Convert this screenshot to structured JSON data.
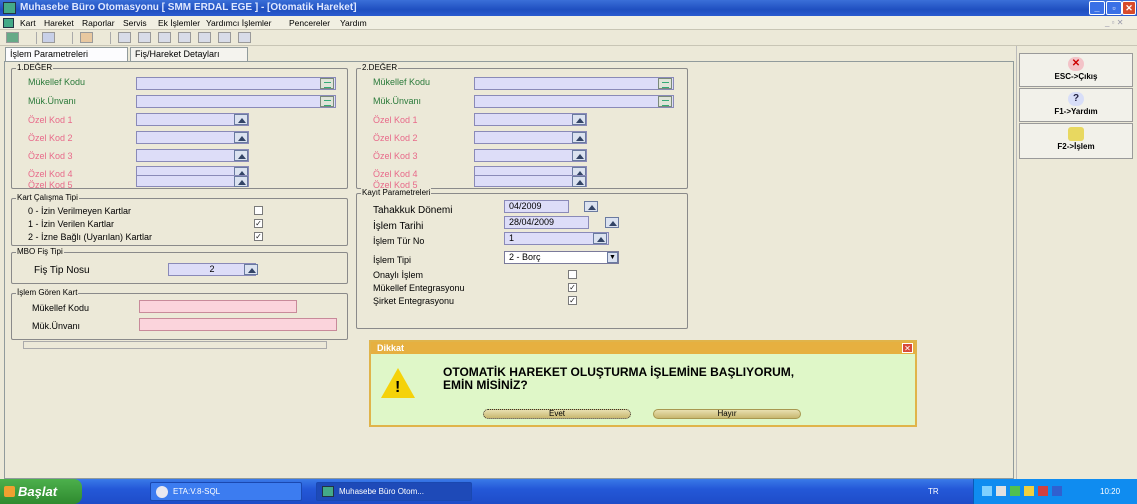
{
  "window": {
    "title": "Muhasebe Büro Otomasyonu [ SMM ERDAL EGE ] - [Otomatik Hareket]"
  },
  "menu": [
    "Kart",
    "Hareket",
    "Raporlar",
    "Servis",
    "Ek İşlemler",
    "Yardımcı İşlemler",
    "Pencereler",
    "Yardım"
  ],
  "tabs": [
    "İşlem Parametreleri",
    "Fiş/Hareket Detayları"
  ],
  "deger1": {
    "title": "1.DEĞER",
    "mukellef_kodu": "Mükellef Kodu",
    "muk_unvani": "Mük.Ünvanı",
    "ozel_kod": [
      "Özel Kod 1",
      "Özel Kod 2",
      "Özel Kod 3",
      "Özel Kod 4",
      "Özel Kod 5"
    ]
  },
  "deger2": {
    "title": "2.DEĞER",
    "mukellef_kodu": "Mükellef Kodu",
    "muk_unvani": "Mük.Ünvanı",
    "ozel_kod": [
      "Özel Kod 1",
      "Özel Kod 2",
      "Özel Kod 3",
      "Özel Kod 4",
      "Özel Kod 5"
    ]
  },
  "kart_calisma": {
    "title": "Kart Çalışma Tipi",
    "items": [
      {
        "label": "0 - İzin Verilmeyen Kartlar",
        "checked": false
      },
      {
        "label": "1 - İzin Verilen Kartlar",
        "checked": true
      },
      {
        "label": "2 - İzne Bağlı (Uyarılan) Kartlar",
        "checked": true
      }
    ]
  },
  "mbo": {
    "title": "MBO Fiş Tipi",
    "label": "Fiş Tip Nosu",
    "value": "2"
  },
  "islem_goren": {
    "title": "İşlem Gören Kart",
    "mukellef_kodu": "Mükellef Kodu",
    "muk_unvani": "Mük.Ünvanı"
  },
  "kayit": {
    "title": "Kayıt Parametreleri",
    "tahakkuk_label": "Tahakkuk Dönemi",
    "tahakkuk_value": "04/2009",
    "islem_tarihi_label": "İşlem Tarihi",
    "islem_tarihi_value": "28/04/2009",
    "islem_tur_label": "İşlem Tür No",
    "islem_tur_value": "1",
    "islem_tipi_label": "İşlem Tipi",
    "islem_tipi_value": "2 - Borç",
    "onayli_label": "Onaylı İşlem",
    "mukellef_ent_label": "Mükellef Entegrasyonu",
    "sirket_ent_label": "Şirket Entegrasyonu"
  },
  "right_buttons": [
    "ESC->Çıkış",
    "F1->Yardım",
    "F2->İşlem"
  ],
  "dialog": {
    "title": "Dikkat",
    "line1": "OTOMATİK HAREKET OLUŞTURMA İŞLEMİNE BAŞLIYORUM,",
    "line2": "EMİN MİSİNİZ?",
    "yes": "Evet",
    "no": "Hayır"
  },
  "taskbar": {
    "start": "Başlat",
    "task1": "ETA:V.8-SQL",
    "task2": "Muhasebe Büro Otom...",
    "lang": "TR",
    "clock": "10:20"
  }
}
